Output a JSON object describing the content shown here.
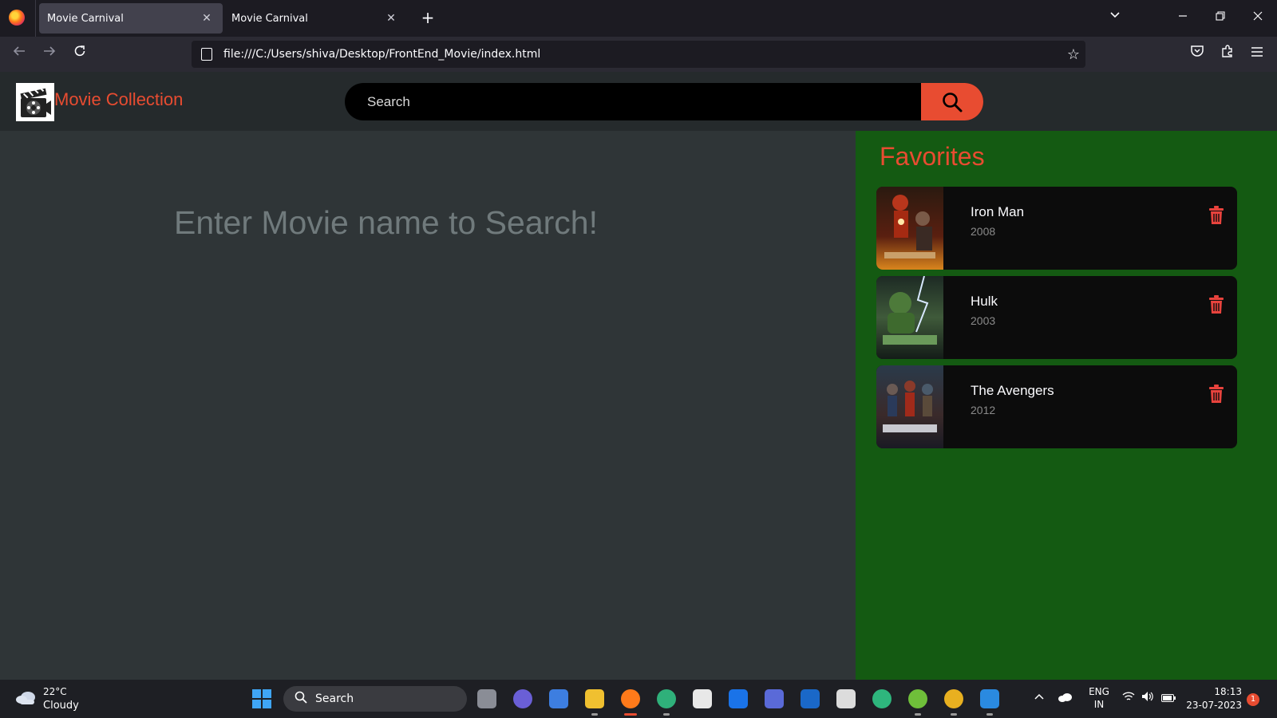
{
  "browser": {
    "tabs": [
      {
        "title": "Movie Carnival",
        "active": true
      },
      {
        "title": "Movie Carnival",
        "active": false
      }
    ],
    "new_tab_label": "+",
    "address": "file:///C:/Users/shiva/Desktop/FrontEnd_Movie/index.html"
  },
  "site": {
    "brand": "Movie Collection",
    "search_placeholder": "Search",
    "accent_color": "#e84c31"
  },
  "main": {
    "prompt": "Enter Movie name to Search!"
  },
  "favorites": {
    "title": "Favorites",
    "items": [
      {
        "name": "Iron Man",
        "year": "2008",
        "poster_icon": "iron-man-poster"
      },
      {
        "name": "Hulk",
        "year": "2003",
        "poster_icon": "hulk-poster"
      },
      {
        "name": "The Avengers",
        "year": "2012",
        "poster_icon": "avengers-poster"
      }
    ]
  },
  "taskbar": {
    "weather_temp": "22°C",
    "weather_condition": "Cloudy",
    "search_label": "Search",
    "language_1": "ENG",
    "language_2": "IN",
    "time": "18:13",
    "date": "23-07-2023",
    "notification_count": "1"
  }
}
